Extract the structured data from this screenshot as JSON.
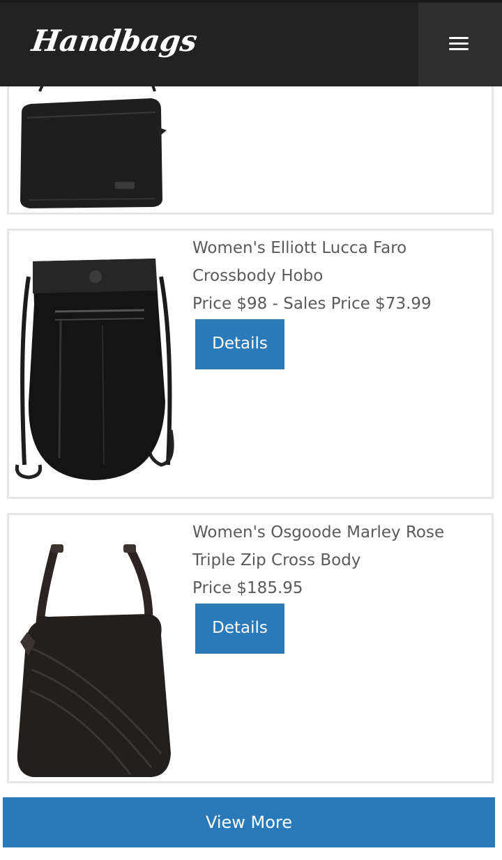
{
  "header": {
    "logo_text": "Handbags",
    "menu_icon": "hamburger-menu-icon"
  },
  "products": [
    {
      "name": "",
      "price": "",
      "image_icon": "black-crossbody-bag-image"
    },
    {
      "name": "Women's Elliott Lucca Faro Crossbody Hobo",
      "price": "Price $98 - Sales Price $73.99",
      "details_label": "Details",
      "image_icon": "black-hobo-bag-image"
    },
    {
      "name": "Women's Osgoode Marley Rose Triple Zip Cross Body",
      "price": "Price $185.95",
      "details_label": "Details",
      "image_icon": "brown-cross-body-bag-image"
    }
  ],
  "view_more_label": "View More",
  "colors": {
    "header_bg": "#222222",
    "accent_blue": "#2a7ab9",
    "card_border": "#e6e6e6",
    "text_gray": "#5a5a5a"
  }
}
